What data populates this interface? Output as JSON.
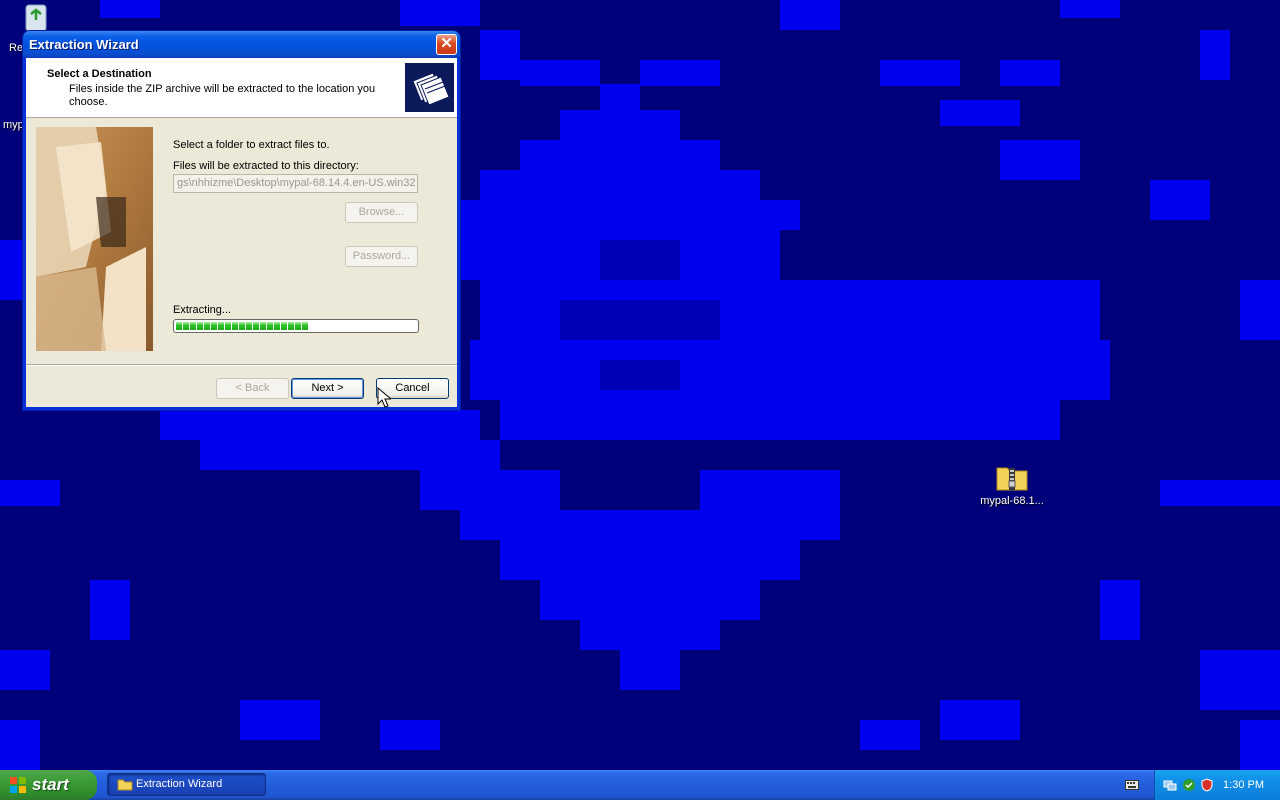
{
  "desktop": {
    "icons": [
      {
        "label": "Re"
      },
      {
        "label": "myp"
      },
      {
        "label": "mypal-68.1..."
      }
    ]
  },
  "window": {
    "title": "Extraction Wizard",
    "close_glyph": "✕",
    "header": {
      "title": "Select a Destination",
      "subtitle": "Files inside the ZIP archive will be extracted to the location you choose."
    },
    "body": {
      "select_label": "Select a folder to extract files to.",
      "dir_label": "Files will be extracted to this directory:",
      "path_value": "gs\\nhhizme\\Desktop\\mypal-68.14.4.en-US.win32",
      "browse_label": "Browse...",
      "password_label": "Password...",
      "extracting_label": "Extracting...",
      "progress_percent": 56
    },
    "buttons": {
      "back": "< Back",
      "next": "Next >",
      "cancel": "Cancel"
    }
  },
  "taskbar": {
    "start_label": "start",
    "task_label": "Extraction Wizard",
    "clock": "1:30 PM"
  }
}
